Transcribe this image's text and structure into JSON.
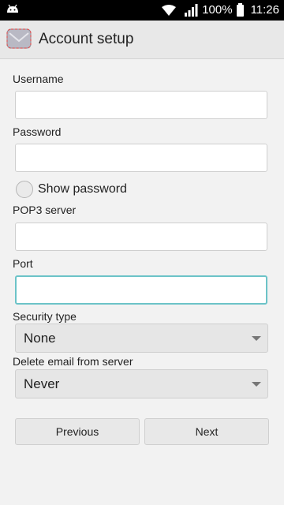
{
  "status_bar": {
    "battery_percent": "100%",
    "time": "11:26",
    "icons": [
      "android-icon",
      "wifi-icon",
      "signal-icon",
      "battery-icon"
    ]
  },
  "app_bar": {
    "title": "Account setup",
    "icon": "email-app-icon"
  },
  "form": {
    "username_label": "Username",
    "username_value": "",
    "password_label": "Password",
    "password_value": "",
    "show_password_label": "Show password",
    "show_password_checked": false,
    "pop3_label": "POP3 server",
    "pop3_value": "",
    "port_label": "Port",
    "port_value": "",
    "security_label": "Security type",
    "security_value": "None",
    "delete_label": "Delete email from server",
    "delete_value": "Never"
  },
  "buttons": {
    "previous": "Previous",
    "next": "Next"
  },
  "colors": {
    "focus_border": "#6cc3c8",
    "status_bar_bg": "#000000"
  }
}
